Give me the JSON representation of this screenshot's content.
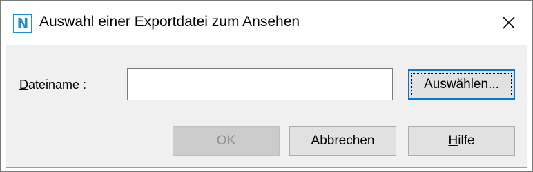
{
  "window": {
    "title": "Auswahl einer Exportdatei zum Ansehen",
    "app_icon_letter": "N",
    "icon_color": "#1f8fd1"
  },
  "form": {
    "filename_label_first": "D",
    "filename_label_rest": "ateiname :",
    "filename_value": ""
  },
  "buttons": {
    "select_pre": "Aus",
    "select_underlined": "w",
    "select_post": "ählen...",
    "ok": "OK",
    "cancel": "Abbrechen",
    "help_underlined": "H",
    "help_rest": "ilfe"
  },
  "colors": {
    "accent_focus": "#0078d7",
    "button_face": "#e1e1e1",
    "dialog_background": "#f0f0f0"
  }
}
